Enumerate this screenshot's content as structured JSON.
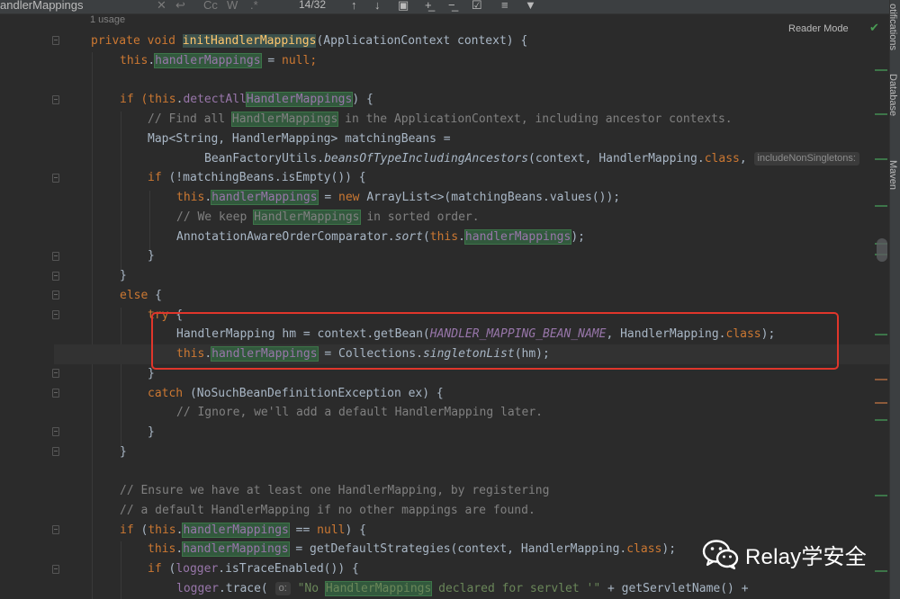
{
  "find_bar": {
    "search_text": "andlerMappings",
    "match_case": "Cc",
    "whole_word": "W",
    "regex": ".*",
    "count": "14/32"
  },
  "editor": {
    "usage_hint": "1 usage",
    "reader_mode": "Reader Mode",
    "inlay_hint_include": "includeNonSingletons:",
    "inlay_hint_o": "o:"
  },
  "side_tools": [
    "Notifications",
    "Database",
    "Maven"
  ],
  "side_tools_visible": [
    "otifications",
    "Database",
    "Maven"
  ],
  "code_lines": {
    "l1a": "private void ",
    "l1fn": "initHandlerMappings",
    "l1b": "(ApplicationContext context) {",
    "l2a": "this",
    "l2b": ".",
    "l2f": "handlerMappings",
    "l2c": " = ",
    "l2d": "null",
    "l2e": ";",
    "l4a": "if (",
    "l4b": "this",
    "l4c": ".",
    "l4f1": "detectAll",
    "l4f2": "HandlerMappings",
    "l4d": ") {",
    "l5a": "// Find all ",
    "l5h": "HandlerMappings",
    "l5b": " in the ApplicationContext, including ancestor contexts.",
    "l6": "Map<String, HandlerMapping> matchingBeans =",
    "l7a": "BeanFactoryUtils.",
    "l7b": "beansOfTypeIncludingAncestors",
    "l7c": "(context, HandlerMapping.",
    "l7d": "class",
    "l7e": ", ",
    "l8a": "if",
    "l8b": " (!matchingBeans.isEmpty()) {",
    "l9a": "this",
    "l9b": ".",
    "l9f": "handlerMappings",
    "l9c": " = ",
    "l9d": "new",
    "l9e": " ArrayList<>(matchingBeans.values());",
    "l10a": "// We keep ",
    "l10h": "HandlerMappings",
    "l10b": " in sorted order.",
    "l11a": "AnnotationAwareOrderComparator.",
    "l11b": "sort",
    "l11c": "(",
    "l11d": "this",
    "l11e": ".",
    "l11f": "handlerMappings",
    "l11g": ");",
    "l12": "}",
    "l13": "}",
    "l14a": "else",
    "l14b": " {",
    "l15a": "try",
    "l15b": " {",
    "l16a": "HandlerMapping hm = context.getBean(",
    "l16b": "HANDLER_MAPPING_BEAN_NAME",
    "l16c": ", HandlerMapping.",
    "l16d": "class",
    "l16e": ");",
    "l17a": "this",
    "l17b": ".",
    "l17f": "handlerMappings",
    "l17c": " = Collections.",
    "l17d": "singletonList",
    "l17e": "(hm);",
    "l18": "}",
    "l19a": "catch",
    "l19b": " (NoSuchBeanDefinitionException ex) {",
    "l20": "// Ignore, we'll add a default HandlerMapping later.",
    "l21": "}",
    "l22": "}",
    "l24": "// Ensure we have at least one HandlerMapping, by registering",
    "l25": "// a default HandlerMapping if no other mappings are found.",
    "l26a": "if",
    "l26b": " (",
    "l26c": "this",
    "l26d": ".",
    "l26f": "handlerMappings",
    "l26e": " == ",
    "l26g": "null",
    "l26h": ") {",
    "l27a": "this",
    "l27b": ".",
    "l27f": "handlerMappings",
    "l27c": " = getDefaultStrategies(context, HandlerMapping.",
    "l27d": "class",
    "l27e": ");",
    "l28a": "if",
    "l28b": " (",
    "l28c": "logger",
    "l28d": ".isTraceEnabled()) {",
    "l29a": "logger",
    "l29b": ".trace( ",
    "l29s1": "\"No ",
    "l29h": "HandlerMappings",
    "l29s2": " declared for servlet '\"",
    "l29c": " + getServletName() +"
  },
  "watermark": {
    "text": "Relay学安全",
    "icon": "wechat-icon"
  },
  "colors": {
    "background": "#2b2b2b",
    "keyword": "#cc7832",
    "method": "#ffc66d",
    "comment": "#808080",
    "field": "#9876aa",
    "search_highlight": "#32593d",
    "red_box": "#e0362b"
  }
}
